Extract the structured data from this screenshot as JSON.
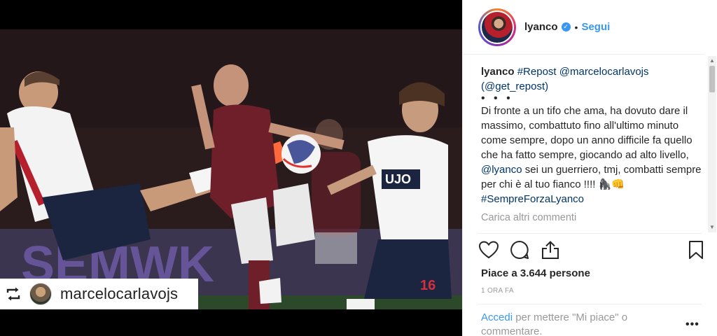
{
  "media": {
    "repost_badge": {
      "icon": "repost-icon",
      "username": "marcelocarlavojs"
    }
  },
  "header": {
    "username": "lyanco",
    "verified": true,
    "separator": "•",
    "follow_label": "Segui"
  },
  "caption": {
    "username": "lyanco",
    "hashtag_repost": "#Repost",
    "mention_source": "@marcelocarlavojs",
    "get_repost": "(@get_repost)",
    "dots": "• • •",
    "body_part1": "Di fronte a un tifo che ama, ha dovuto dare il massimo, combattuto fino all'ultimo minuto come sempre, dopo un anno difficile fa quello che ha fatto sempre, giocando ad alto livello,",
    "mention_lyanco": "@lyanco",
    "body_part2": "sei un guerriero, tmj, combatti sempre per chi è al tuo fianco !!!! 🦍👊",
    "hashtag_end": "#SempreForzaLyanco"
  },
  "load_more_label": "Carica altri commenti",
  "actions": {
    "like_icon": "heart-icon",
    "comment_icon": "comment-icon",
    "share_icon": "share-icon",
    "save_icon": "bookmark-icon"
  },
  "likes_text": "Piace a 3.644 persone",
  "timestamp": "1 ORA FA",
  "login": {
    "link_label": "Accedi",
    "rest": "per mettere \"Mi piace\" o commentare."
  },
  "more_options": "•••",
  "colors": {
    "link_blue": "#3897f0",
    "mention_navy": "#003569",
    "muted_gray": "#999999"
  }
}
